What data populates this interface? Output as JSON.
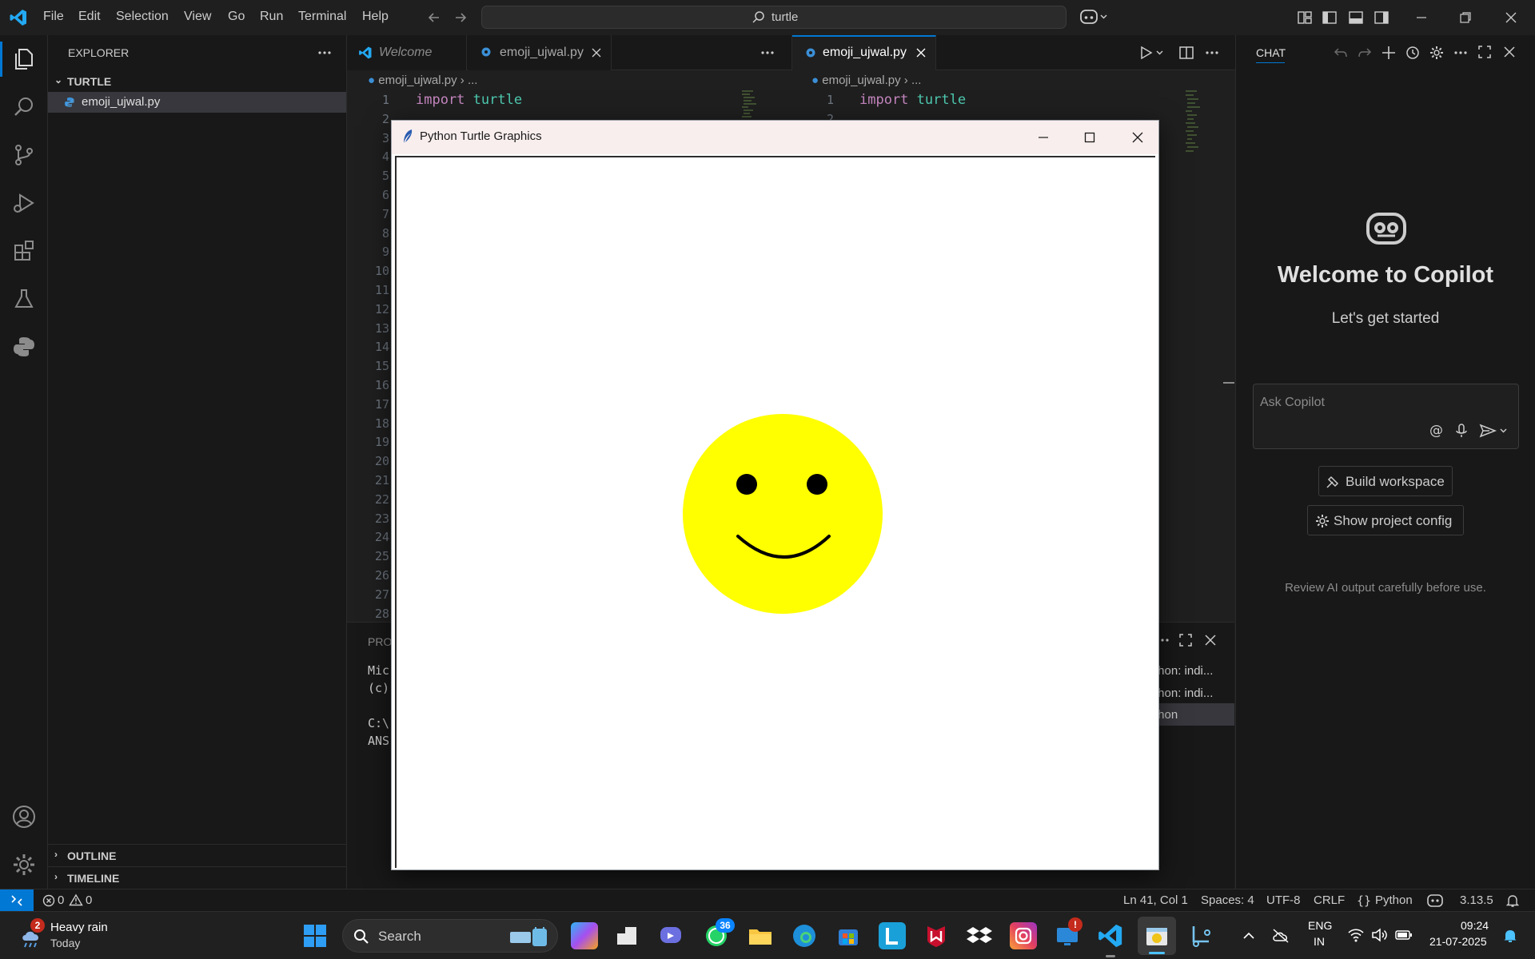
{
  "menu": [
    "File",
    "Edit",
    "Selection",
    "View",
    "Go",
    "Run",
    "Terminal",
    "Help"
  ],
  "command_center": {
    "text": "turtle"
  },
  "sidebar": {
    "title": "EXPLORER",
    "folder": "TURTLE",
    "files": [
      "emoji_ujwal.py"
    ],
    "outline": "OUTLINE",
    "timeline": "TIMELINE"
  },
  "editor_left": {
    "tabs": [
      {
        "label": "Welcome",
        "italic": true
      },
      {
        "label": "emoji_ujwal.py"
      }
    ],
    "breadcrumb": {
      "file": "emoji_ujwal.py",
      "rest": "..."
    },
    "line_numbers": [
      "1",
      "2",
      "3",
      "4",
      "5",
      "6",
      "7",
      "8",
      "9",
      "10",
      "11",
      "12",
      "13",
      "14",
      "15",
      "16",
      "17",
      "18",
      "19",
      "20",
      "21",
      "22",
      "23",
      "24",
      "25",
      "26",
      "27",
      "28"
    ],
    "code_line1": {
      "keyword": "import",
      "module": "turtle"
    }
  },
  "editor_right": {
    "tabs": [
      {
        "label": "emoji_ujwal.py"
      }
    ],
    "breadcrumb": {
      "file": "emoji_ujwal.py",
      "rest": "..."
    },
    "line_numbers": [
      "1",
      "2"
    ],
    "code_line1": {
      "keyword": "import",
      "module": "turtle"
    }
  },
  "panel": {
    "tab_partial": "PROB",
    "terminal_lines": [
      "Mic",
      "(c)",
      "",
      "C:\\",
      "ANS"
    ],
    "terminal_list": [
      "thon: indi...",
      "thon: indi...",
      "thon"
    ]
  },
  "turtle_window": {
    "title": "Python Turtle Graphics",
    "face_color": "#ffff00",
    "feature_color": "#000000"
  },
  "chat": {
    "header": "CHAT",
    "welcome_title": "Welcome to Copilot",
    "welcome_subtitle": "Let's get started",
    "input_placeholder": "Ask Copilot",
    "build_button": "Build workspace",
    "config_button": "Show project config",
    "disclaimer": "Review AI output carefully before use."
  },
  "statusbar": {
    "errors": "0",
    "warnings": "0",
    "position": "Ln 41, Col 1",
    "spaces": "Spaces: 4",
    "encoding": "UTF-8",
    "eol": "CRLF",
    "language": "Python",
    "version": "3.13.5"
  },
  "taskbar": {
    "weather_badge": "2",
    "weather_title": "Heavy rain",
    "weather_sub": "Today",
    "search": "Search",
    "whatsapp_badge": "36",
    "store_badge": "!",
    "lang_top": "ENG",
    "lang_bottom": "IN",
    "time": "09:24",
    "date": "21-07-2025"
  },
  "colors": {
    "accent": "#0078d4",
    "vscode_blue": "#23a9f2",
    "face": "#ffff00"
  }
}
